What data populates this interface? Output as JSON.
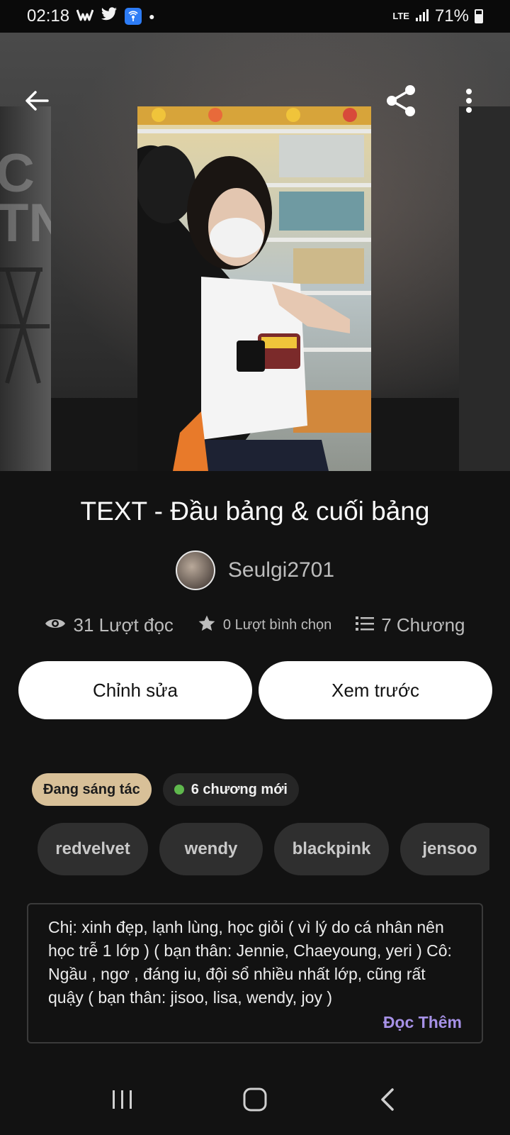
{
  "status_bar": {
    "time": "02:18",
    "battery": "71%",
    "network": "LTE"
  },
  "app_bar": {
    "back_icon": "arrow-left-icon",
    "share_icon": "share-icon",
    "more_icon": "more-vertical-icon"
  },
  "story": {
    "title": "TEXT - Đầu bảng & cuối bảng",
    "author": "Seulgi2701",
    "stats": {
      "reads": "31 Lượt đọc",
      "votes": "0 Lượt bình chọn",
      "chapters": "7 Chương"
    }
  },
  "actions": {
    "edit_label": "Chỉnh sửa",
    "preview_label": "Xem trước"
  },
  "badges": {
    "status": "Đang sáng tác",
    "new_chapters": "6 chương mới"
  },
  "tags": [
    "redvelvet",
    "wendy",
    "blackpink",
    "jensoo"
  ],
  "description": {
    "text": "Chị: xinh đẹp, lạnh lùng, học giỏi ( vì lý do cá nhân nên học trễ 1 lớp ) ( bạn thân: Jennie, Chaeyoung, yeri ) Cô: Ngầu , ngơ , đáng iu, đội sổ nhiều nhất lớp, cũng rất quậy ( bạn thân: jisoo, lisa, wendy, joy )",
    "read_more": "Đọc Thêm"
  },
  "colors": {
    "background": "#121212",
    "status_badge": "#d8c098",
    "new_dot": "#5fb84d",
    "read_more": "#a691e6"
  }
}
